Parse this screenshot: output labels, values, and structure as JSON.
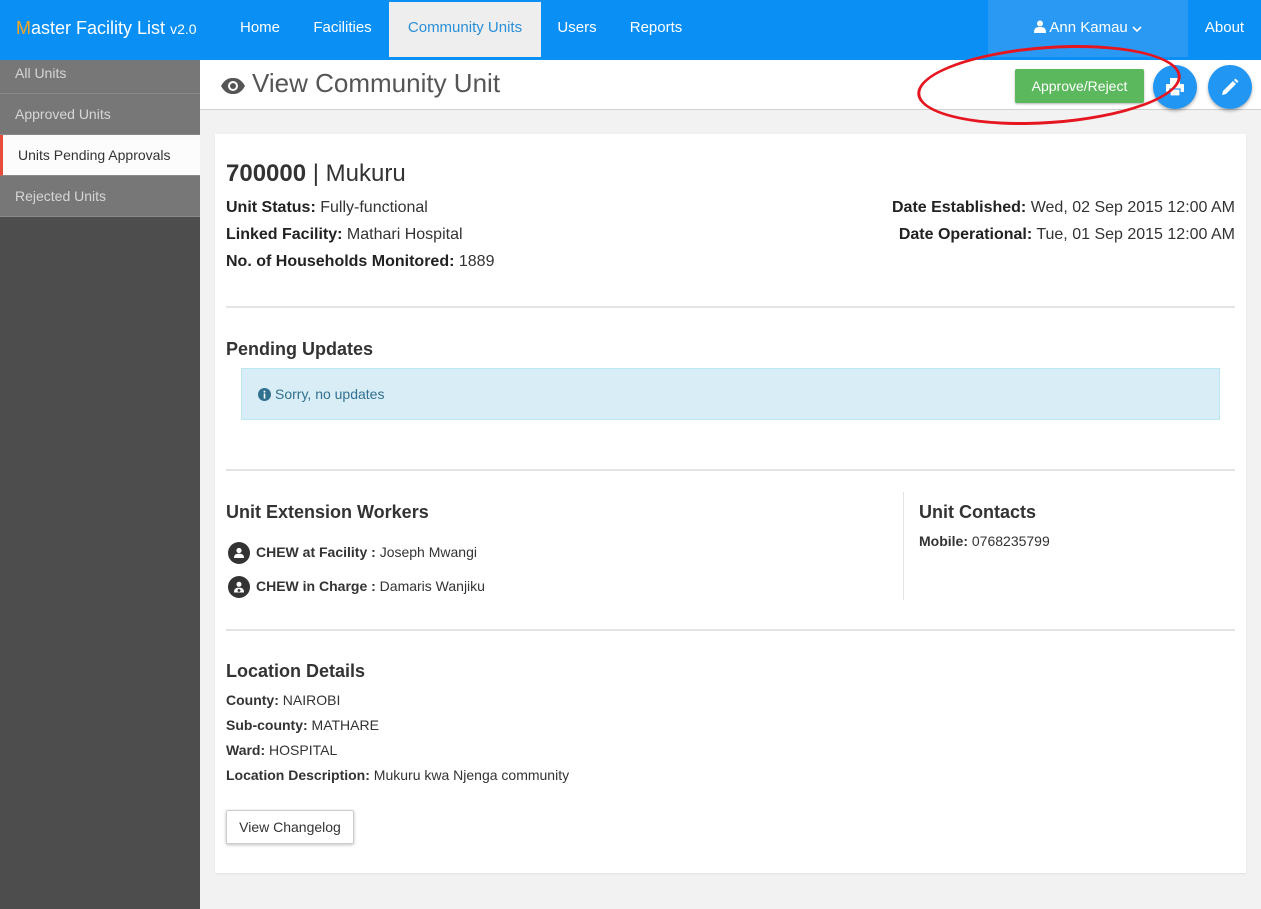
{
  "brand": {
    "first_letter": "M",
    "rest": "aster Facility List",
    "version": "v2.0"
  },
  "nav": {
    "items": [
      {
        "label": "Home"
      },
      {
        "label": "Facilities"
      },
      {
        "label": "Community Units"
      },
      {
        "label": "Users"
      },
      {
        "label": "Reports"
      }
    ],
    "user": "Ann Kamau",
    "about": "About"
  },
  "sidebar": {
    "items": [
      {
        "label": "All Units"
      },
      {
        "label": "Approved Units"
      },
      {
        "label": "Units Pending Approvals"
      },
      {
        "label": "Rejected Units"
      }
    ]
  },
  "header": {
    "title": "View Community Unit",
    "approve_label": "Approve/Reject"
  },
  "unit": {
    "code": "700000",
    "separator": "|",
    "name": "Mukuru",
    "status_label": "Unit Status:",
    "status": "Fully-functional",
    "facility_label": "Linked Facility:",
    "facility": "Mathari Hospital",
    "households_label": "No. of Households Monitored:",
    "households": "1889",
    "established_label": "Date Established:",
    "established": "Wed, 02 Sep 2015 12:00 AM",
    "operational_label": "Date Operational:",
    "operational": "Tue, 01 Sep 2015 12:00 AM"
  },
  "pending": {
    "heading": "Pending Updates",
    "message": "Sorry, no updates"
  },
  "workers": {
    "heading": "Unit Extension Workers",
    "items": [
      {
        "label": "CHEW at Facility :",
        "name": "Joseph Mwangi"
      },
      {
        "label": "CHEW in Charge :",
        "name": "Damaris Wanjiku"
      }
    ]
  },
  "contacts": {
    "heading": "Unit Contacts",
    "mobile_label": "Mobile:",
    "mobile": "0768235799"
  },
  "location": {
    "heading": "Location Details",
    "county_label": "County:",
    "county": "NAIROBI",
    "subcounty_label": "Sub-county:",
    "subcounty": "MATHARE",
    "ward_label": "Ward:",
    "ward": "HOSPITAL",
    "description_label": "Location Description:",
    "description": "Mukuru kwa Njenga community"
  },
  "changelog_label": "View Changelog"
}
